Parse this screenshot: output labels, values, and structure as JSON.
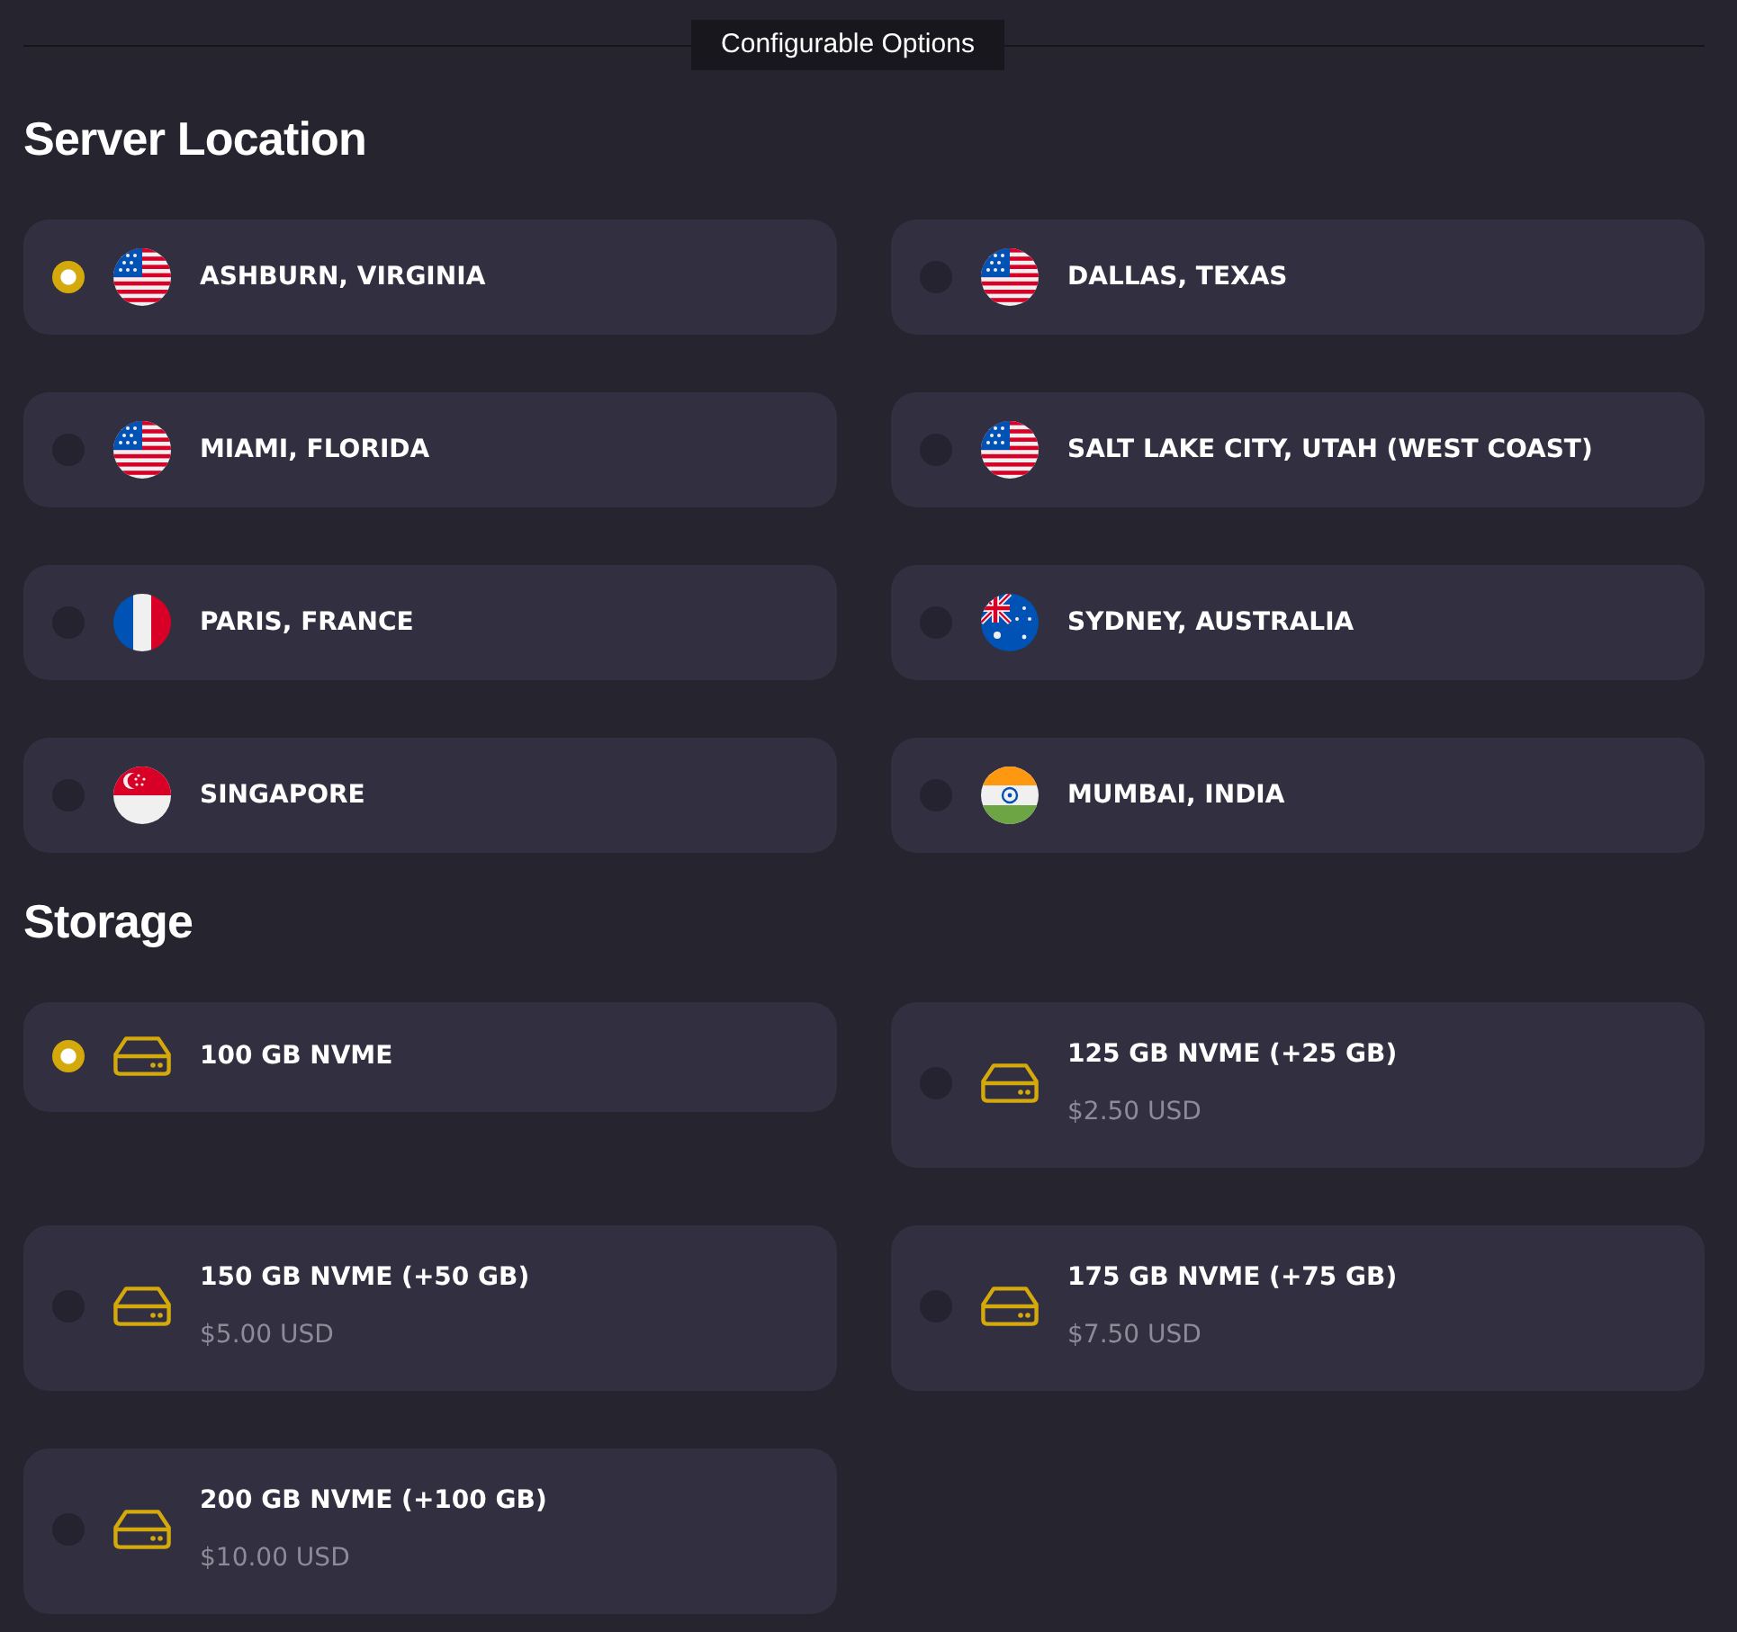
{
  "section_header": {
    "title": "Configurable Options"
  },
  "server_location": {
    "heading": "Server Location",
    "options": [
      {
        "label": "ASHBURN, VIRGINIA",
        "selected": true
      },
      {
        "label": "DALLAS, TEXAS",
        "selected": false
      },
      {
        "label": "MIAMI, FLORIDA",
        "selected": false
      },
      {
        "label": "SALT LAKE CITY, UTAH (WEST COAST)",
        "selected": false
      },
      {
        "label": "PARIS, FRANCE",
        "selected": false
      },
      {
        "label": "SYDNEY, AUSTRALIA",
        "selected": false
      },
      {
        "label": "SINGAPORE",
        "selected": false
      },
      {
        "label": "MUMBAI, INDIA",
        "selected": false
      }
    ]
  },
  "storage": {
    "heading": "Storage",
    "options": [
      {
        "label": "100 GB NVME",
        "selected": true
      },
      {
        "label": "125 GB NVME (+25 GB)",
        "price": "$2.50 USD",
        "selected": false
      },
      {
        "label": "150 GB NVME (+50 GB)",
        "price": "$5.00 USD",
        "selected": false
      },
      {
        "label": "175 GB NVME (+75 GB)",
        "price": "$7.50 USD",
        "selected": false
      },
      {
        "label": "200 GB NVME (+100 GB)",
        "price": "$10.00 USD",
        "selected": false
      }
    ]
  }
}
